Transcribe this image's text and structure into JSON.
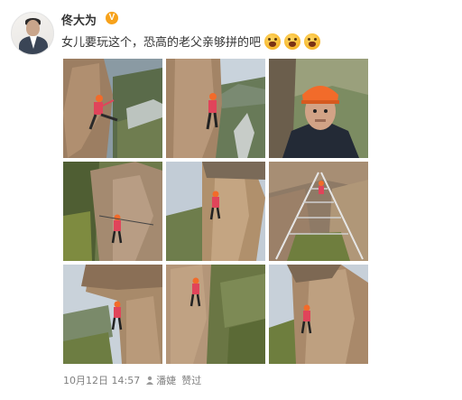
{
  "post": {
    "username": "佟大为",
    "verified_badge": "V",
    "text": "女儿要玩这个，恐高的老父亲够拼的吧",
    "emoji_count": 3,
    "emoji_icon": "scared-face-emoji",
    "footer": {
      "date": "10月12日 14:57",
      "liker": "潘婕",
      "liked_label": "赞过"
    }
  },
  "photos": [
    {
      "name": "photo-1",
      "scene": "climber-red-jacket-cliff-side"
    },
    {
      "name": "photo-2",
      "scene": "climber-on-cliff-valley-view"
    },
    {
      "name": "photo-3",
      "scene": "man-orange-helmet-selfie"
    },
    {
      "name": "photo-4",
      "scene": "climber-on-rock-face-trees"
    },
    {
      "name": "photo-5",
      "scene": "climber-on-tall-rock-pillar"
    },
    {
      "name": "photo-6",
      "scene": "cable-bridge-over-gorge"
    },
    {
      "name": "photo-7",
      "scene": "climber-under-overhang"
    },
    {
      "name": "photo-8",
      "scene": "climber-on-vertical-wall"
    },
    {
      "name": "photo-9",
      "scene": "climber-on-rock-pillar-sky"
    }
  ],
  "colors": {
    "badge": "#f7a21b",
    "text": "#333333",
    "meta": "#808080",
    "helmet": "#f26b2a",
    "jacket": "#e0445a"
  }
}
